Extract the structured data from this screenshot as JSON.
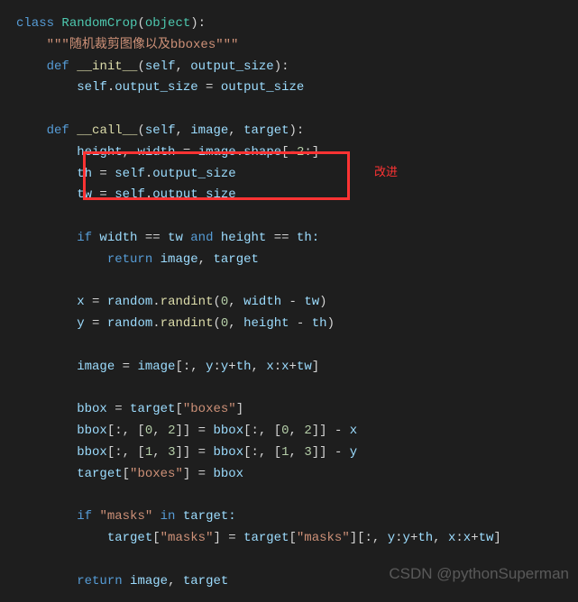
{
  "code": {
    "l1_class": "class",
    "l1_name": "RandomCrop",
    "l1_paren_open": "(",
    "l1_object": "object",
    "l1_paren_close": "):",
    "l2_doc": "\"\"\"随机裁剪图像以及bboxes\"\"\"",
    "l3_def": "def",
    "l3_name": "__init__",
    "l3_sig_open": "(",
    "l3_self": "self",
    "l3_comma": ", ",
    "l3_p1": "output_size",
    "l3_sig_close": "):",
    "l4_self": "self",
    "l4_dot": ".",
    "l4_attr": "output_size",
    "l4_eq": " = ",
    "l4_val": "output_size",
    "l6_def": "def",
    "l6_name": "__call__",
    "l6_open": "(",
    "l6_self": "self",
    "l6_c1": ", ",
    "l6_p1": "image",
    "l6_c2": ", ",
    "l6_p2": "target",
    "l6_close": "):",
    "l7_h": "height",
    "l7_c1": ", ",
    "l7_w": "width",
    "l7_eq": " = ",
    "l7_img": "image",
    "l7_dot": ".",
    "l7_shape": "shape",
    "l7_br": "[-",
    "l7_n": "2",
    "l7_end": ":]",
    "l8_th": "th",
    "l8_eq": " = ",
    "l8_self": "self",
    "l8_dot": ".",
    "l8_attr": "output_size",
    "l9_tw": "tw",
    "l9_eq": " = ",
    "l9_self": "self",
    "l9_dot": ".",
    "l9_attr": "output_size",
    "l11_if": "if",
    "l11_w": " width ",
    "l11_eq1": "==",
    "l11_tw": " tw ",
    "l11_and": "and",
    "l11_h": " height ",
    "l11_eq2": "==",
    "l11_th": " th:",
    "l12_ret": "return",
    "l12_img": " image",
    "l12_c": ", ",
    "l12_tgt": "target",
    "l14_x": "x",
    "l14_eq": " = ",
    "l14_rnd": "random",
    "l14_dot": ".",
    "l14_fn": "randint",
    "l14_op": "(",
    "l14_z": "0",
    "l14_c": ", ",
    "l14_w": "width",
    "l14_m": " - ",
    "l14_tw": "tw",
    "l14_cl": ")",
    "l15_y": "y",
    "l15_eq": " = ",
    "l15_rnd": "random",
    "l15_dot": ".",
    "l15_fn": "randint",
    "l15_op": "(",
    "l15_z": "0",
    "l15_c": ", ",
    "l15_h": "height",
    "l15_m": " - ",
    "l15_th": "th",
    "l15_cl": ")",
    "l17_img1": "image",
    "l17_eq": " = ",
    "l17_img2": "image",
    "l17_sl": "[:, ",
    "l17_y1": "y",
    "l17_c1": ":",
    "l17_y2": "y",
    "l17_p1": "+",
    "l17_th": "th",
    "l17_c2": ", ",
    "l17_x1": "x",
    "l17_c3": ":",
    "l17_x2": "x",
    "l17_p2": "+",
    "l17_tw": "tw",
    "l17_end": "]",
    "l19_bb": "bbox",
    "l19_eq": " = ",
    "l19_tgt": "target",
    "l19_br": "[",
    "l19_key": "\"boxes\"",
    "l19_end": "]",
    "l20_bb1": "bbox",
    "l20_s1": "[:, [",
    "l20_n1": "0",
    "l20_c1": ", ",
    "l20_n2": "2",
    "l20_s2": "]] = ",
    "l20_bb2": "bbox",
    "l20_s3": "[:, [",
    "l20_n3": "0",
    "l20_c2": ", ",
    "l20_n4": "2",
    "l20_s4": "]] - ",
    "l20_x": "x",
    "l21_bb1": "bbox",
    "l21_s1": "[:, [",
    "l21_n1": "1",
    "l21_c1": ", ",
    "l21_n2": "3",
    "l21_s2": "]] = ",
    "l21_bb2": "bbox",
    "l21_s3": "[:, [",
    "l21_n3": "1",
    "l21_c2": ", ",
    "l21_n4": "3",
    "l21_s4": "]] - ",
    "l21_y": "y",
    "l22_tgt": "target",
    "l22_br": "[",
    "l22_key": "\"boxes\"",
    "l22_br2": "] = ",
    "l22_bb": "bbox",
    "l24_if": "if",
    "l24_sp": " ",
    "l24_key": "\"masks\"",
    "l24_sp2": " ",
    "l24_in": "in",
    "l24_tgt": " target:",
    "l25_tgt1": "target",
    "l25_b1": "[",
    "l25_k1": "\"masks\"",
    "l25_b2": "] = ",
    "l25_tgt2": "target",
    "l25_b3": "[",
    "l25_k2": "\"masks\"",
    "l25_b4": "][:, ",
    "l25_y1": "y",
    "l25_c1": ":",
    "l25_y2": "y",
    "l25_p1": "+",
    "l25_th": "th",
    "l25_c2": ", ",
    "l25_x1": "x",
    "l25_c3": ":",
    "l25_x2": "x",
    "l25_p2": "+",
    "l25_tw": "tw",
    "l25_end": "]",
    "l27_ret": "return",
    "l27_img": " image",
    "l27_c": ", ",
    "l27_tgt": "target"
  },
  "annotation": "改进",
  "watermark": "CSDN @pythonSuperman"
}
